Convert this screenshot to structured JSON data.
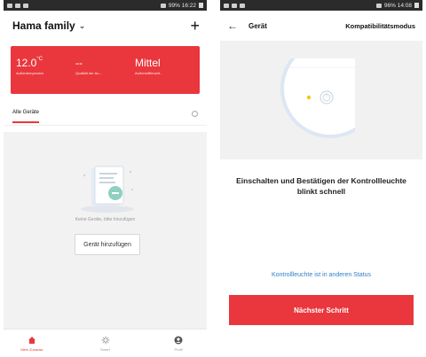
{
  "left": {
    "statusbar": {
      "right_text": "99% 16:22"
    },
    "header": {
      "title": "Hama family",
      "add_symbol": "+"
    },
    "weather": [
      {
        "value": "12.0",
        "unit": "°C",
        "label": "Außentemperatur"
      },
      {
        "value": "--",
        "unit": "",
        "label": "Qualität der Au..."
      },
      {
        "value": "Mittel",
        "unit": "",
        "label": "Außenluftfeucht..."
      }
    ],
    "tab_label": "Alle Geräte",
    "empty_text": "Keine Geräte, bitte hinzufügen",
    "add_button": "Gerät hinzufügen",
    "nav": [
      {
        "label": "Mein Zuhause",
        "icon": "home-icon"
      },
      {
        "label": "Smart",
        "icon": "sun-icon"
      },
      {
        "label": "Profil",
        "icon": "profile-icon"
      }
    ],
    "colors": {
      "accent": "#e9373d"
    }
  },
  "right": {
    "statusbar": {
      "right_text": "96% 14:08"
    },
    "header": {
      "back_symbol": "←",
      "title": "Gerät",
      "mode": "Kompatibilitätsmodus"
    },
    "instruction": "Einschalten und Bestätigen der Kontrollleuchte blinkt schnell",
    "status_link": "Kontrollleuchte ist in anderen Status",
    "next_button": "Nächster Schritt",
    "colors": {
      "link": "#2f7fc6",
      "button": "#e9373d"
    }
  }
}
